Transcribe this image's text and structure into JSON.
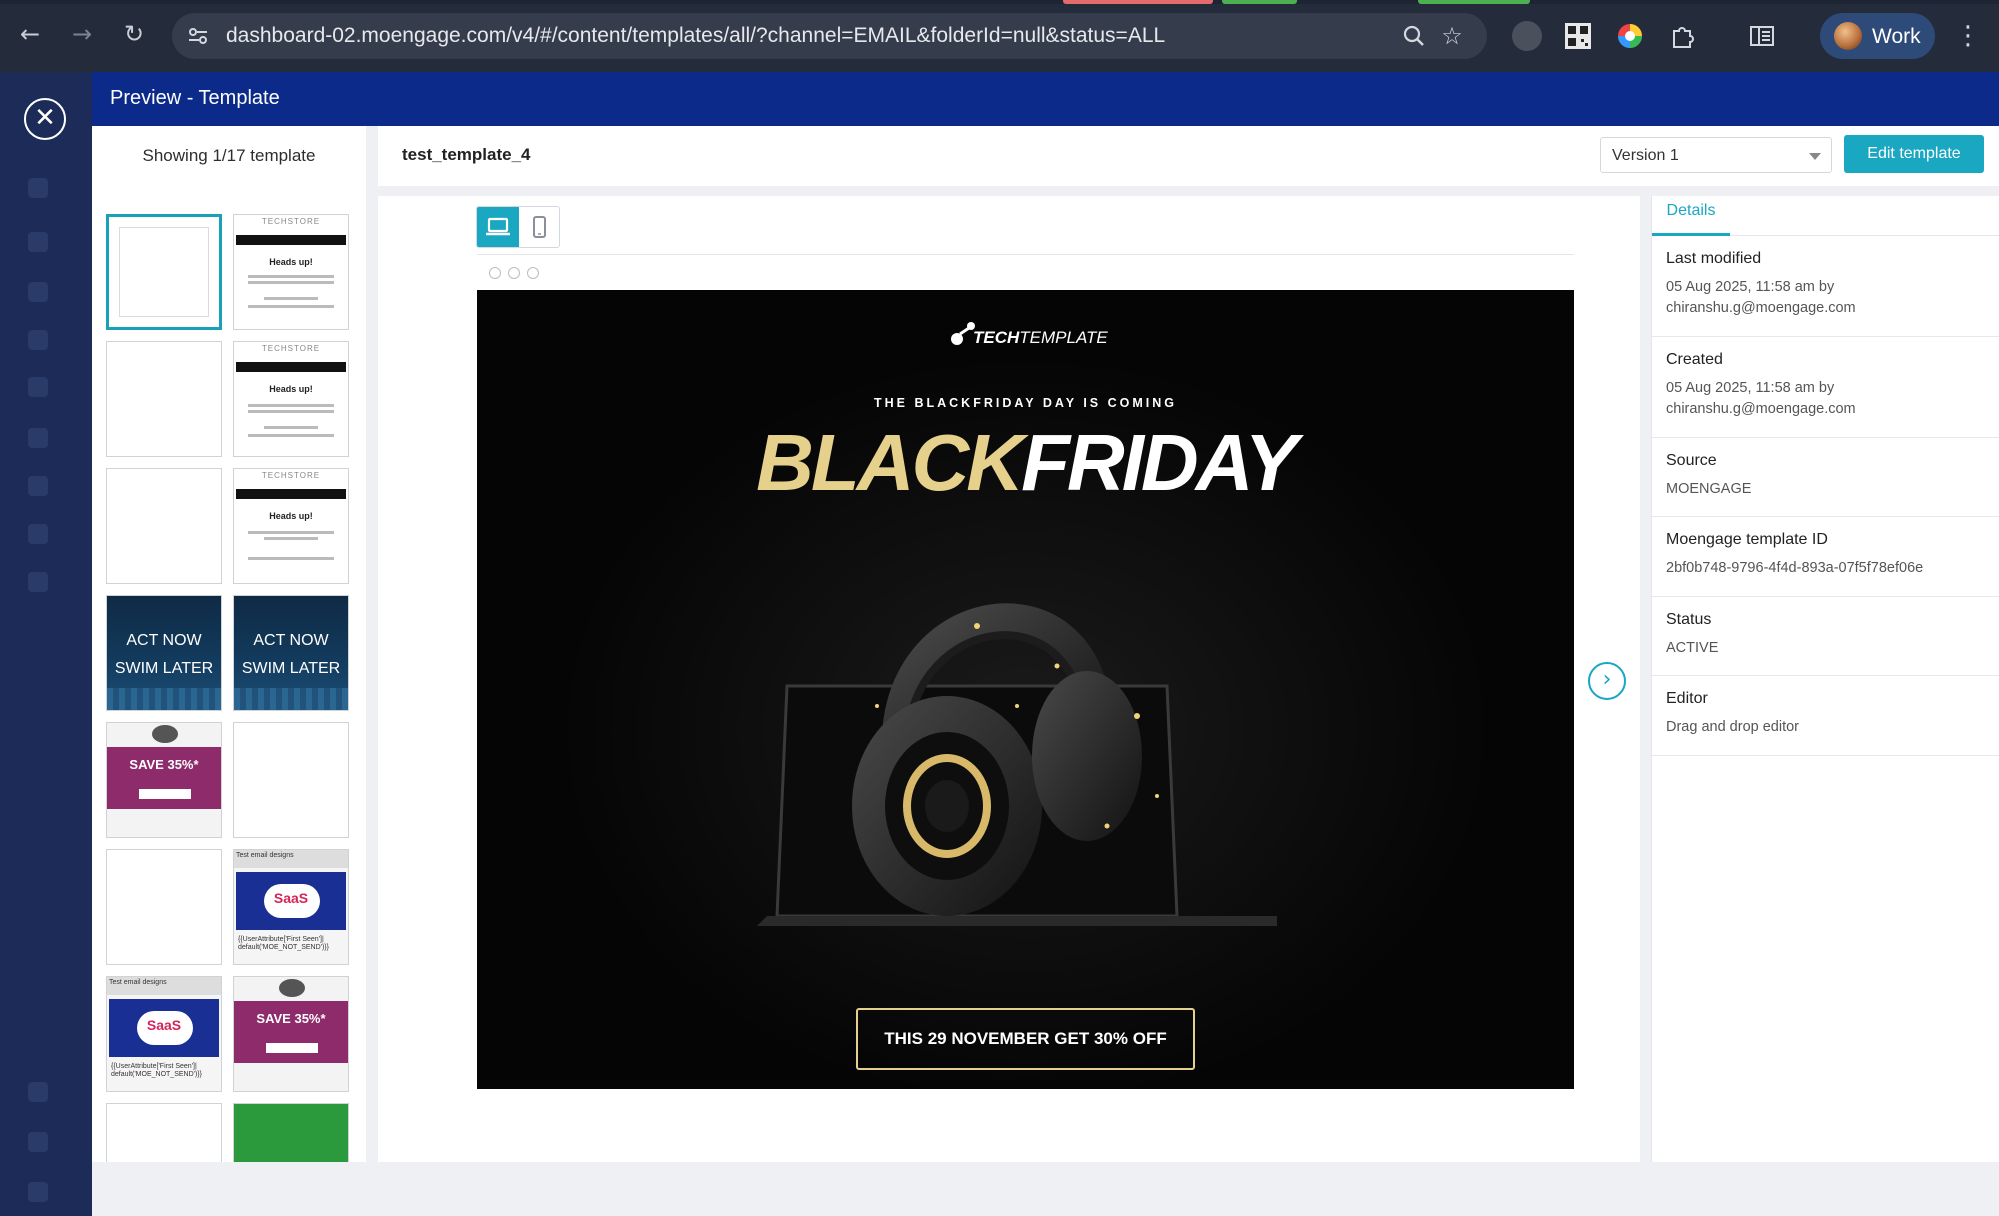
{
  "browser": {
    "url": "dashboard-02.moengage.com/v4/#/content/templates/all/?channel=EMAIL&folderId=null&status=ALL",
    "profile_label": "Work"
  },
  "modal": {
    "title": "Preview - Template",
    "close_icon": "close-icon"
  },
  "thumbnails": {
    "showing_text": "Showing 1/17 template",
    "swim_line1": "ACT NOW",
    "swim_line2": "SWIM LATER",
    "save_text": "SAVE 35%*",
    "saas_text": "SaaS",
    "saas_header": "Test email designs",
    "saas_footer": "{{UserAttribute['First Seen']| default('MOE_NOT_SEND')}}",
    "heads_up": "Heads up!",
    "techstore": "TECHSTORE"
  },
  "topbar": {
    "template_name": "test_template_4",
    "version_selected": "Version 1",
    "edit_button": "Edit template"
  },
  "email": {
    "brand_bold": "TECH",
    "brand_rest": "TEMPLATE",
    "subheading": "THE BLACKFRIDAY DAY IS COMING",
    "headline_a": "BLACK",
    "headline_b": "FRIDAY",
    "cta": "THIS 29 NOVEMBER GET 30% OFF"
  },
  "details": {
    "tab": "Details",
    "last_modified_label": "Last modified",
    "last_modified_value": "05 Aug 2025, 11:58 am by",
    "last_modified_by": "chiranshu.g@moengage.com",
    "created_label": "Created",
    "created_value": "05 Aug 2025, 11:58 am by",
    "created_by": "chiranshu.g@moengage.com",
    "source_label": "Source",
    "source_value": "MOENGAGE",
    "template_id_label": "Moengage template ID",
    "template_id_value": "2bf0b748-9796-4f4d-893a-07f5f78ef06e",
    "status_label": "Status",
    "status_value": "ACTIVE",
    "editor_label": "Editor",
    "editor_value": "Drag and drop editor"
  },
  "colors": {
    "accent": "#19a7c2",
    "header": "#0b2a8a",
    "gold": "#e5d08c"
  }
}
